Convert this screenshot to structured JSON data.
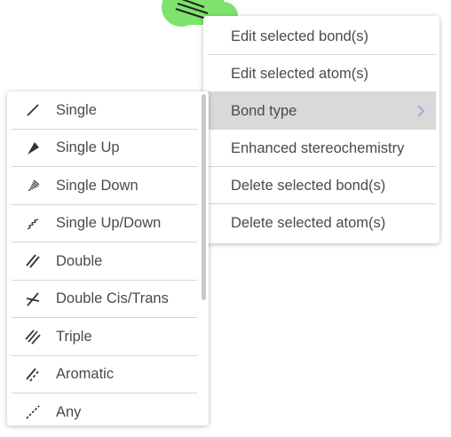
{
  "canvas": {
    "highlight_color": "#7ee36a"
  },
  "context_menu": {
    "items": [
      {
        "label": "Edit selected bond(s)"
      },
      {
        "label": "Edit selected atom(s)"
      },
      {
        "label": "Bond type",
        "has_submenu": true,
        "active": true
      },
      {
        "label": "Enhanced stereochemistry"
      },
      {
        "label": "Delete selected bond(s)"
      },
      {
        "label": "Delete selected atom(s)"
      }
    ]
  },
  "bond_type_menu": {
    "items": [
      {
        "label": "Single",
        "icon": "single-bond-icon"
      },
      {
        "label": "Single Up",
        "icon": "single-up-bond-icon"
      },
      {
        "label": "Single Down",
        "icon": "single-down-bond-icon"
      },
      {
        "label": "Single Up/Down",
        "icon": "single-up-down-bond-icon"
      },
      {
        "label": "Double",
        "icon": "double-bond-icon"
      },
      {
        "label": "Double Cis/Trans",
        "icon": "double-cis-trans-bond-icon"
      },
      {
        "label": "Triple",
        "icon": "triple-bond-icon"
      },
      {
        "label": "Aromatic",
        "icon": "aromatic-bond-icon"
      },
      {
        "label": "Any",
        "icon": "any-bond-icon"
      }
    ]
  },
  "colors": {
    "text": "#4a4a4a",
    "active_row": "#d9d9d9",
    "separator": "#d6d6d6",
    "icon": "#333333"
  }
}
